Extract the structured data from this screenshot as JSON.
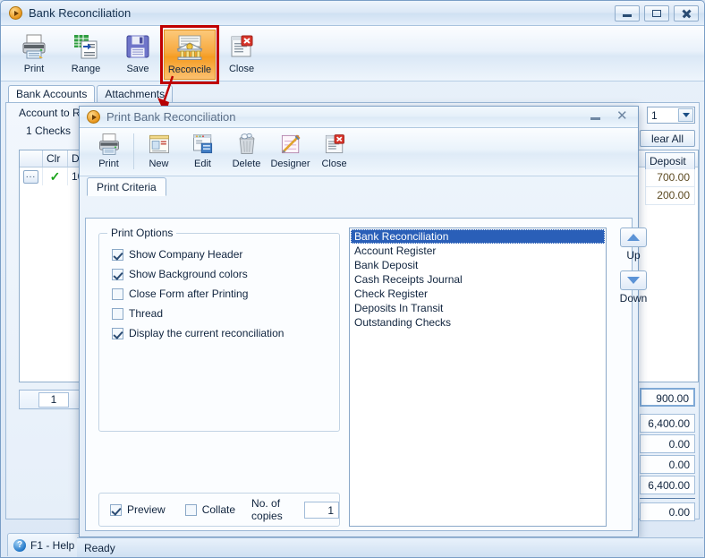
{
  "main_window": {
    "title": "Bank Reconciliation",
    "app_icon": "orb-play-icon",
    "window_buttons": [
      {
        "name": "minimize-button",
        "glyph": "minimize"
      },
      {
        "name": "restore-button",
        "glyph": "restore"
      },
      {
        "name": "close-button",
        "glyph": "close"
      }
    ],
    "toolbar": [
      {
        "label": "Print",
        "icon": "printer-icon"
      },
      {
        "label": "Range",
        "icon": "range-grid-icon"
      },
      {
        "label": "Save",
        "icon": "floppy-disk-icon"
      },
      {
        "label": "Reconcile",
        "icon": "bank-building-icon",
        "highlighted": true
      },
      {
        "label": "Close",
        "icon": "close-document-icon"
      }
    ],
    "tabs": [
      {
        "label": "Bank Accounts",
        "active": true
      },
      {
        "label": "Attachments",
        "active": false
      }
    ],
    "account_label": "Account to R",
    "checks_label": "1 Checks",
    "grid": {
      "columns": [
        "",
        "Clr",
        "Dat"
      ],
      "rows": [
        {
          "button": "...",
          "clr": "✓",
          "date": "10/"
        }
      ]
    },
    "page_number": "1",
    "account_select_value": "1",
    "clear_all_label": "lear All",
    "deposit_column_header": "Deposit",
    "deposit_values": [
      "700.00",
      "200.00"
    ],
    "totals": {
      "highlighted": "900.00",
      "group": [
        "6,400.00",
        "0.00",
        "0.00",
        "6,400.00"
      ],
      "final": "0.00"
    },
    "help_label": "F1 - Help",
    "help_icon": "question-mark-icon"
  },
  "print_dialog": {
    "title": "Print Bank Reconciliation",
    "app_icon": "orb-play-icon",
    "window_buttons": [
      {
        "name": "minimize-button",
        "glyph": "minimize"
      },
      {
        "name": "close-button",
        "glyph": "close"
      }
    ],
    "toolbar": [
      {
        "label": "Print",
        "icon": "printer-icon"
      },
      {
        "label": "New",
        "icon": "new-document-icon"
      },
      {
        "label": "Edit",
        "icon": "edit-document-icon"
      },
      {
        "label": "Delete",
        "icon": "trash-can-icon"
      },
      {
        "label": "Designer",
        "icon": "designer-pencil-icon"
      },
      {
        "label": "Close",
        "icon": "close-document-icon"
      }
    ],
    "tabs": [
      {
        "label": "Print Criteria",
        "active": true
      }
    ],
    "print_options": {
      "legend": "Print Options",
      "items": [
        {
          "label": "Show Company Header",
          "checked": true
        },
        {
          "label": "Show Background colors",
          "checked": true
        },
        {
          "label": "Close Form after Printing",
          "checked": false
        },
        {
          "label": "Thread",
          "checked": false
        },
        {
          "label": "Display the current reconciliation",
          "checked": true
        }
      ]
    },
    "report_list": [
      {
        "label": "Bank Reconciliation",
        "selected": true
      },
      {
        "label": "Account Register",
        "selected": false
      },
      {
        "label": "Bank Deposit",
        "selected": false
      },
      {
        "label": "Cash Receipts Journal",
        "selected": false
      },
      {
        "label": "Check Register",
        "selected": false
      },
      {
        "label": "Deposits In Transit",
        "selected": false
      },
      {
        "label": "Outstanding Checks",
        "selected": false
      }
    ],
    "order_buttons": [
      {
        "label": "Up",
        "icon": "triangle-up-icon"
      },
      {
        "label": "Down",
        "icon": "triangle-down-icon"
      }
    ],
    "bottom_options": {
      "preview": {
        "label": "Preview",
        "checked": true
      },
      "collate": {
        "label": "Collate",
        "checked": false
      },
      "copies_label": "No. of copies",
      "copies_value": "1"
    },
    "status_text": "Ready"
  },
  "annotation": {
    "highlight_color": "#c00000",
    "arrow_color": "#c00000",
    "target": "Reconcile"
  },
  "colors": {
    "selection_blue": "#2a5fb8",
    "highlight_orange": "#f5a623",
    "annotation_red": "#c00000",
    "checkmark_green": "#19a319"
  }
}
